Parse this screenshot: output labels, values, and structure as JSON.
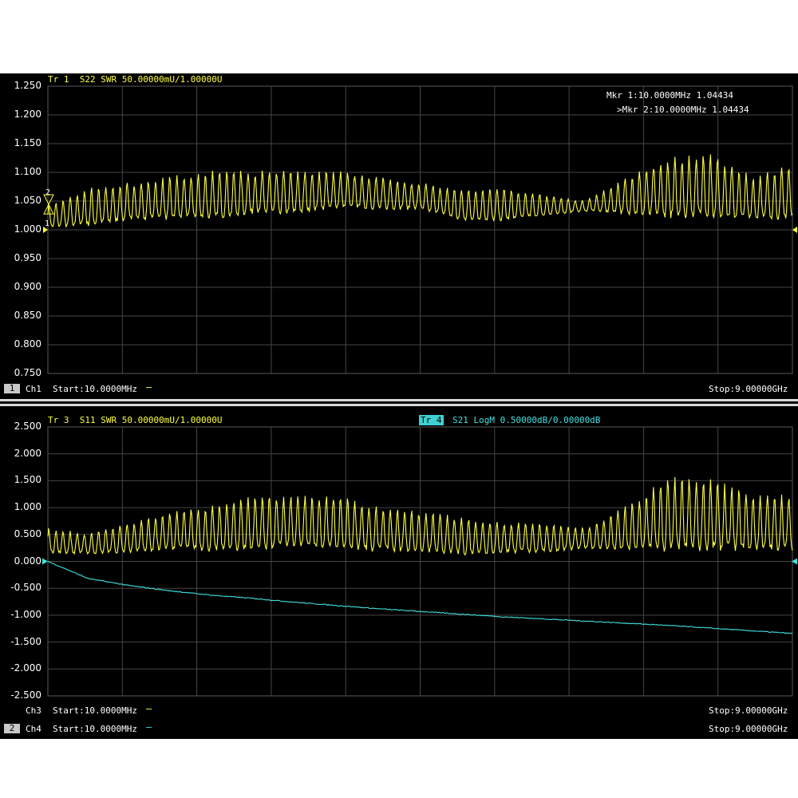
{
  "colors": {
    "trace_yellow": "#ffff40",
    "trace_cyan": "#40e0e0",
    "grid": "#4a4a4a",
    "background": "#000000"
  },
  "top": {
    "trace_header": "Tr 1  S22 SWR 50.00000mU/1.00000U",
    "marker1": "Mkr 1:10.0000MHz 1.04434",
    "marker2": ">Mkr 2:10.0000MHz 1.04434",
    "marker_tags": [
      "2",
      "1"
    ],
    "y_ticks": [
      "1.250",
      "1.200",
      "1.150",
      "1.100",
      "1.050",
      "1.000",
      "0.950",
      "0.900",
      "0.850",
      "0.800",
      "0.750"
    ],
    "channel_number": "1",
    "channel": "Ch1",
    "start": "Start:10.0000MHz",
    "stop": "Stop:9.00000GHz"
  },
  "bottom": {
    "trace3_header": "Tr 3  S11 SWR 50.00000mU/1.00000U",
    "trace4_tag": "Tr 4",
    "trace4_header": "S21 LogM 0.50000dB/0.00000dB",
    "y_ticks": [
      "2.500",
      "2.000",
      "1.500",
      "1.000",
      "0.500",
      "0.000",
      "-0.500",
      "-1.000",
      "-1.500",
      "-2.000",
      "-2.500"
    ],
    "ch3": "Ch3",
    "ch3_start": "Start:10.0000MHz",
    "ch3_stop": "Stop:9.00000GHz",
    "channel_number": "2",
    "ch4": "Ch4",
    "ch4_start": "Start:10.0000MHz",
    "ch4_stop": "Stop:9.00000GHz"
  },
  "chart_data": [
    {
      "type": "line",
      "title": "Tr 1  S22 SWR 50.00000mU/1.00000U",
      "xlabel": "",
      "ylabel": "",
      "x_range": [
        "10.0000MHz",
        "9.00000GHz"
      ],
      "ylim": [
        0.75,
        1.25
      ],
      "grid": true,
      "series": [
        {
          "name": "S22 SWR",
          "color": "#ffff40",
          "envelope_freq_ghz": [
            0.01,
            0.5,
            1.0,
            1.5,
            2.0,
            2.5,
            3.0,
            3.5,
            4.0,
            4.5,
            5.0,
            5.5,
            6.0,
            6.5,
            7.0,
            7.5,
            8.0,
            8.5,
            9.0
          ],
          "upper": [
            1.04,
            1.07,
            1.08,
            1.09,
            1.1,
            1.1,
            1.1,
            1.1,
            1.09,
            1.08,
            1.07,
            1.07,
            1.06,
            1.05,
            1.09,
            1.12,
            1.13,
            1.09,
            1.11
          ],
          "lower": [
            1.0,
            1.0,
            1.01,
            1.01,
            1.01,
            1.02,
            1.02,
            1.03,
            1.03,
            1.03,
            1.01,
            1.01,
            1.02,
            1.03,
            1.02,
            1.01,
            1.01,
            1.01,
            1.01
          ]
        }
      ]
    },
    {
      "type": "line",
      "title": "Tr 3  S11 SWR 50.00000mU/1.00000U",
      "xlabel": "",
      "ylabel": "",
      "x_range": [
        "10.0000MHz",
        "9.00000GHz"
      ],
      "ylim": [
        -2.5,
        2.5
      ],
      "grid": true,
      "series": [
        {
          "name": "S11 SWR",
          "color": "#ffff40",
          "envelope_freq_ghz": [
            0.01,
            0.5,
            1.0,
            1.5,
            2.0,
            2.5,
            3.0,
            3.5,
            4.0,
            4.5,
            5.0,
            5.5,
            6.0,
            6.5,
            7.0,
            7.5,
            8.0,
            8.5,
            9.0
          ],
          "upper": [
            0.6,
            0.5,
            0.7,
            0.9,
            1.0,
            1.2,
            1.2,
            1.2,
            1.0,
            0.9,
            0.8,
            0.7,
            0.7,
            0.6,
            1.0,
            1.5,
            1.5,
            1.2,
            1.2
          ],
          "lower": [
            0.1,
            0.1,
            0.1,
            0.15,
            0.1,
            0.1,
            0.15,
            0.1,
            0.1,
            0.1,
            0.05,
            0.1,
            0.1,
            0.2,
            0.1,
            0.05,
            0.05,
            0.1,
            0.1
          ]
        },
        {
          "name": "S21 LogM",
          "color": "#40e0e0",
          "x_ghz": [
            0.01,
            0.5,
            1.0,
            1.5,
            2.0,
            2.5,
            3.0,
            3.5,
            4.0,
            4.5,
            5.0,
            5.5,
            6.0,
            6.5,
            7.0,
            7.5,
            8.0,
            8.5,
            9.0
          ],
          "y": [
            0.0,
            -0.32,
            -0.45,
            -0.55,
            -0.63,
            -0.69,
            -0.76,
            -0.82,
            -0.88,
            -0.93,
            -0.98,
            -1.03,
            -1.07,
            -1.11,
            -1.15,
            -1.19,
            -1.24,
            -1.29,
            -1.34
          ]
        }
      ]
    }
  ]
}
